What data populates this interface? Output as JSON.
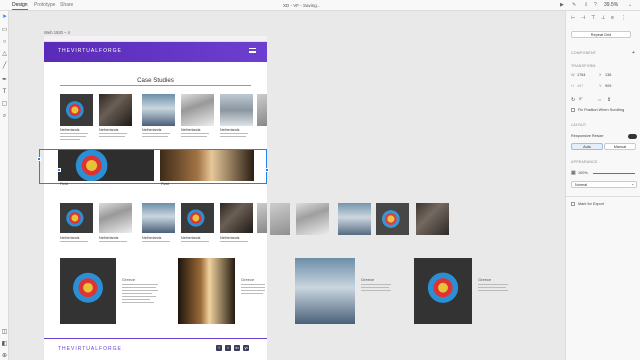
{
  "topbar": {
    "tabs": [
      "Design",
      "Prototype",
      "Share"
    ],
    "doc_title": "XD - VF - Saving...",
    "zoom": "39.5%"
  },
  "tools": [
    "select-arrow-icon",
    "rectangle-icon",
    "ellipse-icon",
    "triangle-icon",
    "line-icon",
    "pen-icon",
    "text-icon",
    "artboard-icon",
    "zoom-icon"
  ],
  "right_panel": {
    "repeat_grid_label": "Repeat Grid",
    "component_label": "COMPONENT",
    "transform_label": "TRANSFORM",
    "w_label": "W",
    "w_value": "1764",
    "x_label": "X",
    "x_value": "136",
    "h_label": "H",
    "h_value": "487",
    "y_label": "Y",
    "y_value": "909",
    "rotation_value": "0°",
    "fix_position_label": "Fix Position When Scrolling",
    "layout_label": "LAYOUT",
    "responsive_label": "Responsive Resize",
    "auto_label": "Auto",
    "manual_label": "Manual",
    "appearance_label": "APPEARANCE",
    "opacity_value": "100%",
    "blend_value": "Normal",
    "export_label": "Mark for Export"
  },
  "artboard": {
    "label": "Web 1920 – 4",
    "logo": "THEVIRTUALFORGE",
    "section_title": "Case Studies",
    "caption": "Netherlands",
    "big_caption": "Field",
    "story_head": "Greece",
    "footer_logo": "THEVIRTUALFORGE",
    "social": [
      "f",
      "t",
      "in",
      "yt"
    ]
  },
  "colors": {
    "accent": "#2680eb",
    "brand_purple": "#6d3fd0"
  }
}
